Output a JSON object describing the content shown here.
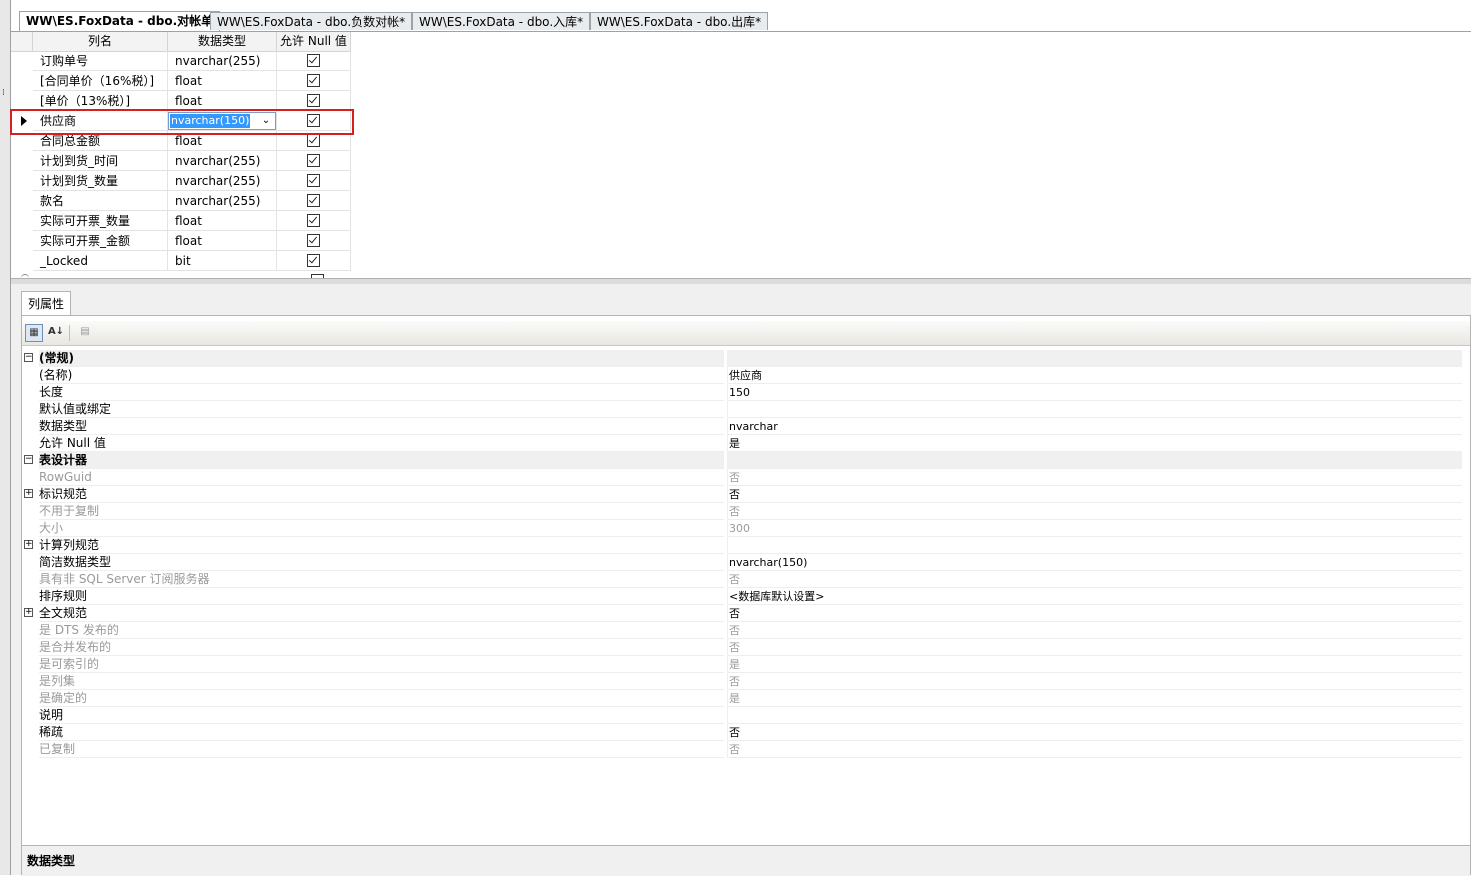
{
  "tabs": [
    {
      "label": "WW\\ES.FoxData - dbo.对帐单",
      "active": true
    },
    {
      "label": "WW\\ES.FoxData - dbo.负数对帐*",
      "active": false
    },
    {
      "label": "WW\\ES.FoxData - dbo.入库*",
      "active": false
    },
    {
      "label": "WW\\ES.FoxData - dbo.出库*",
      "active": false
    }
  ],
  "grid": {
    "headers": {
      "name": "列名",
      "type": "数据类型",
      "nullable": "允许 Null 值"
    },
    "rows": [
      {
        "name": "订购单号",
        "type": "nvarchar(255)",
        "null": true
      },
      {
        "name": "[合同单价（16%税）]",
        "type": "float",
        "null": true
      },
      {
        "name": "[单价（13%税）]",
        "type": "float",
        "null": true
      },
      {
        "name": "供应商",
        "type": "nvarchar(150)",
        "null": true,
        "selected": true
      },
      {
        "name": "合同总金额",
        "type": "float",
        "null": true
      },
      {
        "name": "计划到货_时间",
        "type": "nvarchar(255)",
        "null": true
      },
      {
        "name": "计划到货_数量",
        "type": "nvarchar(255)",
        "null": true
      },
      {
        "name": "款名",
        "type": "nvarchar(255)",
        "null": true
      },
      {
        "name": "实际可开票_数量",
        "type": "float",
        "null": true
      },
      {
        "name": "实际可开票_金额",
        "type": "float",
        "null": true
      },
      {
        "name": "_Locked",
        "type": "bit",
        "null": true
      }
    ]
  },
  "properties": {
    "tab_label": "列属性",
    "rows": [
      {
        "name": "(常规)",
        "value": "",
        "category": true,
        "expander": "⊟"
      },
      {
        "name": "(名称)",
        "value": "供应商"
      },
      {
        "name": "长度",
        "value": "150"
      },
      {
        "name": "默认值或绑定",
        "value": ""
      },
      {
        "name": "数据类型",
        "value": "nvarchar"
      },
      {
        "name": "允许 Null 值",
        "value": "是"
      },
      {
        "name": "表设计器",
        "value": "",
        "category": true,
        "expander": "⊟"
      },
      {
        "name": "RowGuid",
        "value": "否",
        "disabled": true
      },
      {
        "name": "标识规范",
        "value": "否",
        "expander": "⊞"
      },
      {
        "name": "不用于复制",
        "value": "否",
        "disabled": true
      },
      {
        "name": "大小",
        "value": "300",
        "disabled": true
      },
      {
        "name": "计算列规范",
        "value": "",
        "expander": "⊞"
      },
      {
        "name": "简洁数据类型",
        "value": "nvarchar(150)"
      },
      {
        "name": "具有非 SQL Server 订阅服务器",
        "value": "否",
        "disabled": true
      },
      {
        "name": "排序规则",
        "value": "<数据库默认设置>"
      },
      {
        "name": "全文规范",
        "value": "否",
        "expander": "⊞"
      },
      {
        "name": "是 DTS 发布的",
        "value": "否",
        "disabled": true
      },
      {
        "name": "是合并发布的",
        "value": "否",
        "disabled": true
      },
      {
        "name": "是可索引的",
        "value": "是",
        "disabled": true
      },
      {
        "name": "是列集",
        "value": "否",
        "disabled": true
      },
      {
        "name": "是确定的",
        "value": "是",
        "disabled": true
      },
      {
        "name": "说明",
        "value": ""
      },
      {
        "name": "稀疏",
        "value": "否"
      },
      {
        "name": "已复制",
        "value": "否",
        "disabled": true
      }
    ],
    "description_title": "数据类型"
  }
}
